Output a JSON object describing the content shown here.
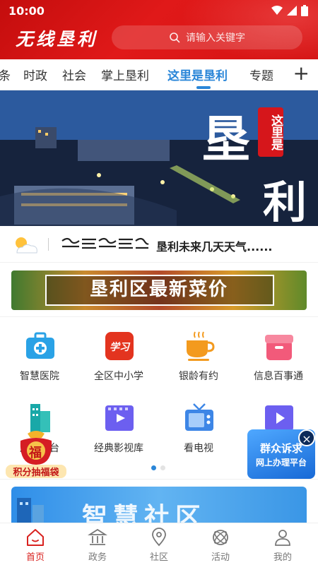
{
  "status_bar": {
    "time": "10:00"
  },
  "header": {
    "logo_text": "无线垦利",
    "search_placeholder": "请输入关键字"
  },
  "tabs": [
    {
      "label": "条"
    },
    {
      "label": "时政"
    },
    {
      "label": "社会"
    },
    {
      "label": "掌上垦利"
    },
    {
      "label": "这里是垦利",
      "active": true
    },
    {
      "label": "专题"
    }
  ],
  "banner": {
    "title_big1": "垦",
    "title_big2": "利",
    "seal_text": "这里是"
  },
  "weather": {
    "text": "垦利未来几天天气......"
  },
  "price_banner": {
    "text": "垦利区最新菜价"
  },
  "grid": [
    {
      "label": "智慧医院",
      "icon": "hospital-icon"
    },
    {
      "label": "全区中小学",
      "icon": "school-icon"
    },
    {
      "label": "银龄有约",
      "icon": "tea-cup-icon"
    },
    {
      "label": "信息百事通",
      "icon": "info-box-icon"
    },
    {
      "label": "居民平台",
      "icon": "building-icon"
    },
    {
      "label": "经典影视库",
      "icon": "film-icon"
    },
    {
      "label": "看电视",
      "icon": "tv-icon"
    },
    {
      "label": "",
      "icon": "video-icon"
    }
  ],
  "floating": {
    "fu_char": "福",
    "fu_caption": "积分抽福袋",
    "ad_line1": "群众诉求",
    "ad_line2": "网上办理平台"
  },
  "community": {
    "text": "智慧社区"
  },
  "bottom_nav": [
    {
      "label": "首页",
      "icon": "home-icon",
      "active": true
    },
    {
      "label": "政务",
      "icon": "government-icon"
    },
    {
      "label": "社区",
      "icon": "location-icon"
    },
    {
      "label": "活动",
      "icon": "activity-icon"
    },
    {
      "label": "我的",
      "icon": "user-icon"
    }
  ],
  "colors": {
    "primary_red": "#d51414",
    "accent_blue": "#2a86d8"
  }
}
